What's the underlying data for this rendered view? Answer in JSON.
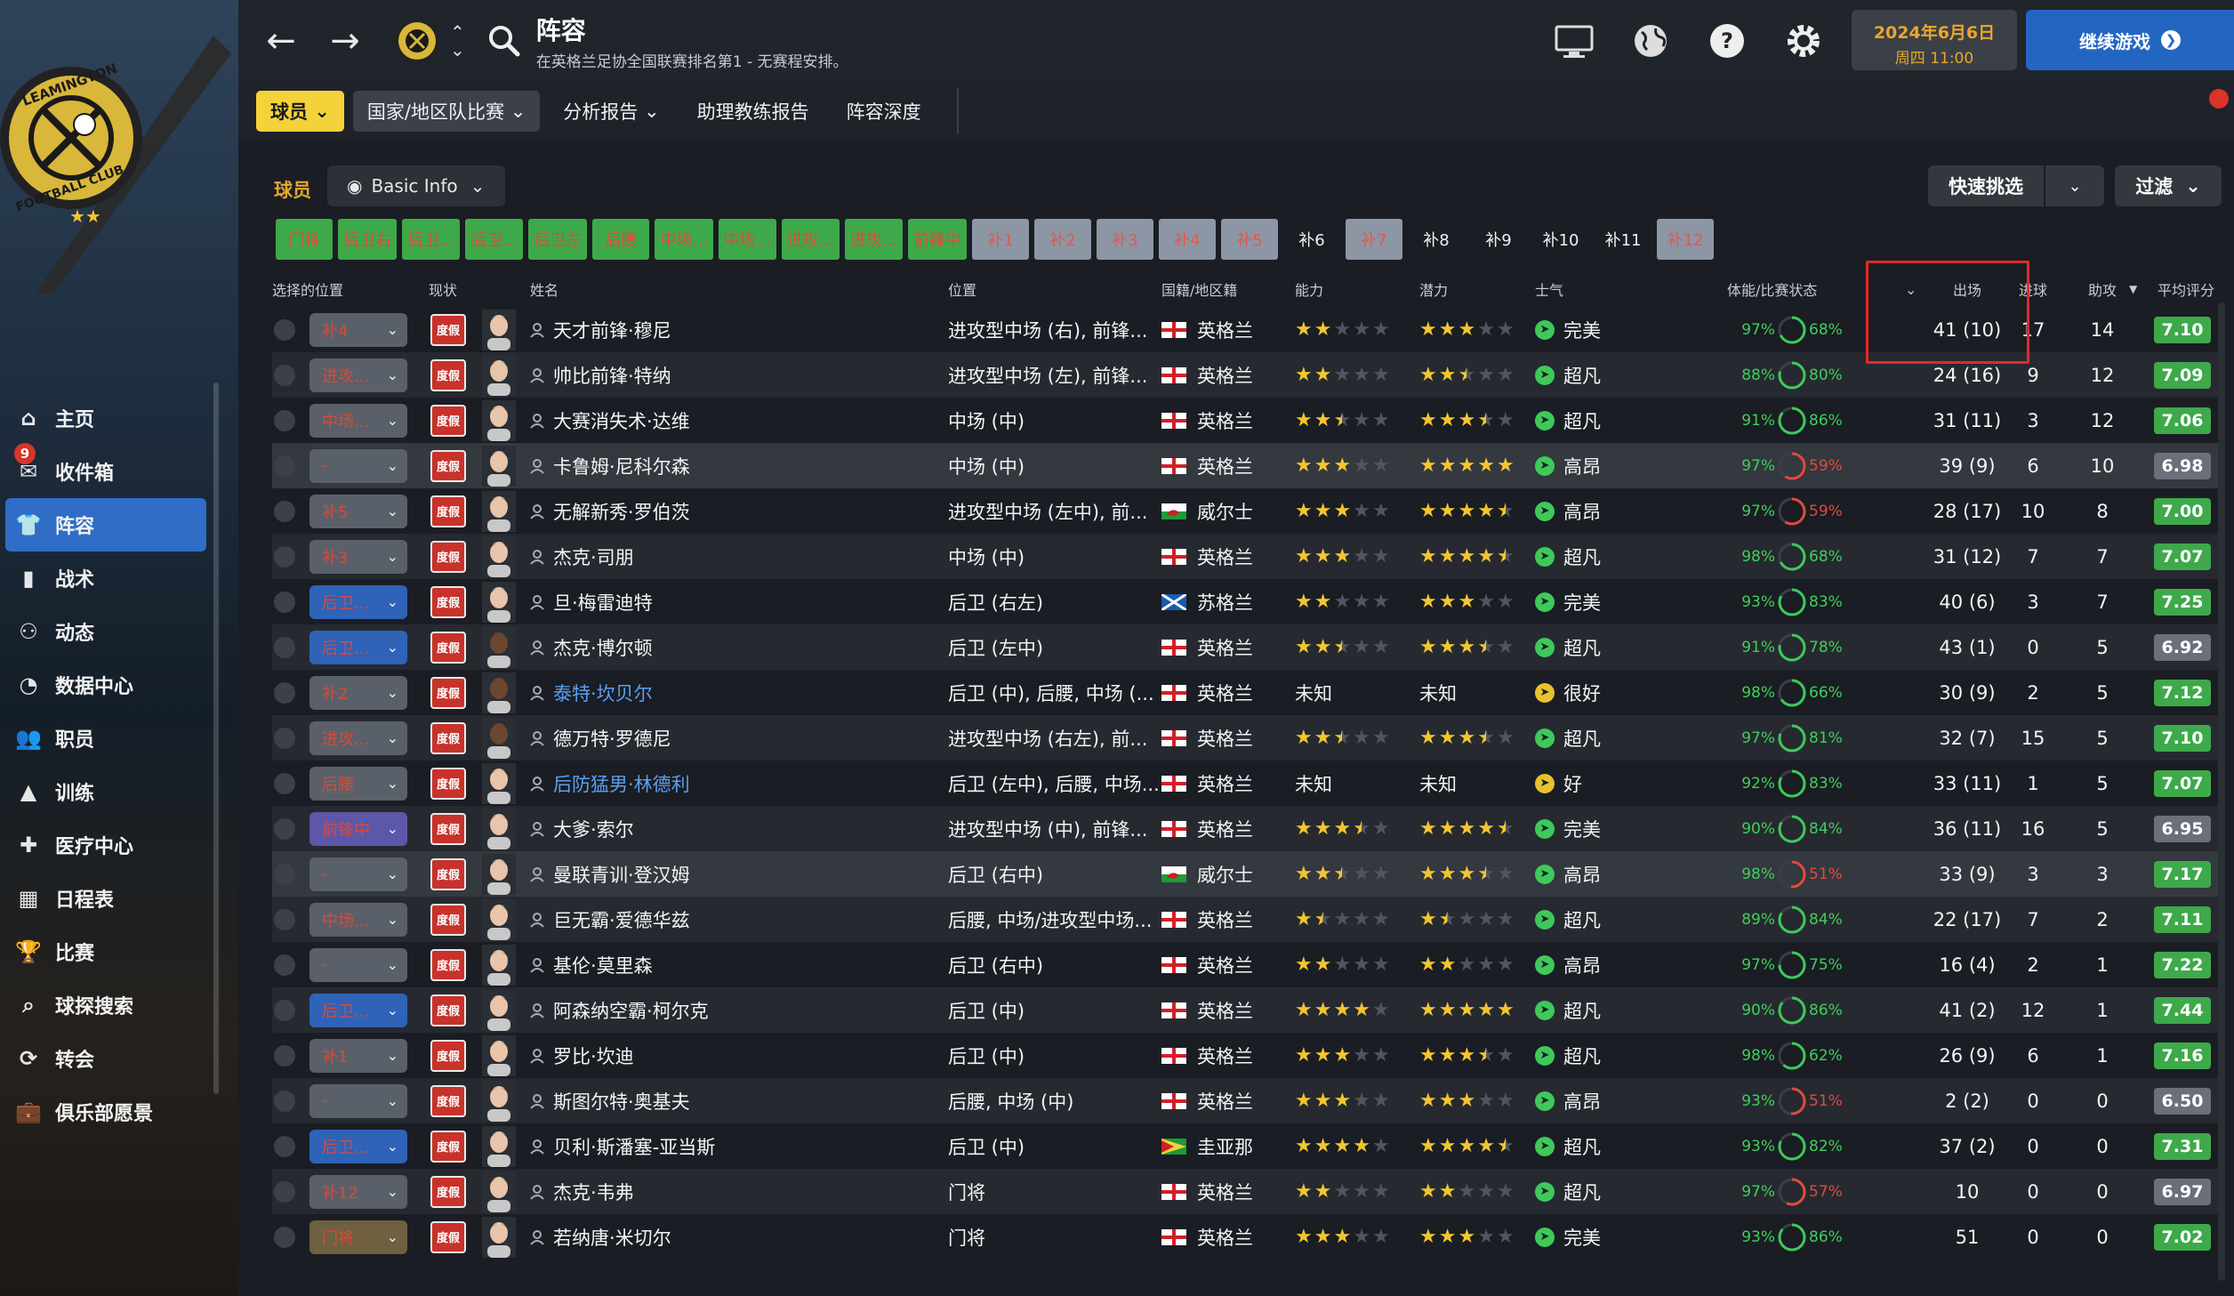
{
  "sidebar": {
    "club_crest_text": "LEAMINGTON FOOTBALL CLUB",
    "items": [
      {
        "label": "主页",
        "icon": "home-icon"
      },
      {
        "label": "收件箱",
        "icon": "inbox-icon",
        "badge": "9"
      },
      {
        "label": "阵容",
        "icon": "shirt-icon",
        "active": true
      },
      {
        "label": "战术",
        "icon": "tactics-icon"
      },
      {
        "label": "动态",
        "icon": "dynamics-icon"
      },
      {
        "label": "数据中心",
        "icon": "data-icon"
      },
      {
        "label": "职员",
        "icon": "staff-icon"
      },
      {
        "label": "训练",
        "icon": "training-icon"
      },
      {
        "label": "医疗中心",
        "icon": "medical-icon"
      },
      {
        "label": "日程表",
        "icon": "calendar-icon"
      },
      {
        "label": "比赛",
        "icon": "trophy-icon"
      },
      {
        "label": "球探搜索",
        "icon": "scout-icon"
      },
      {
        "label": "转会",
        "icon": "transfer-icon"
      },
      {
        "label": "俱乐部愿景",
        "icon": "briefcase-icon"
      }
    ]
  },
  "topbar": {
    "title": "阵容",
    "subtitle": "在英格兰足协全国联赛排名第1 - 无赛程安排。",
    "date": "2024年6月6日",
    "time": "周四 11:00",
    "continue": "继续游戏"
  },
  "subnav": {
    "tabs": [
      "球员",
      "国家/地区队比赛",
      "分析报告",
      "助理教练报告",
      "阵容深度"
    ]
  },
  "player_section": {
    "label": "球员",
    "view": "Basic Info",
    "quick_pick": "快速挑选",
    "filter": "过滤"
  },
  "chips": [
    {
      "label": "门将",
      "style": "green"
    },
    {
      "label": "后卫右",
      "style": "green"
    },
    {
      "label": "后卫...",
      "style": "green"
    },
    {
      "label": "后卫...",
      "style": "green"
    },
    {
      "label": "后卫左",
      "style": "green"
    },
    {
      "label": "后腰",
      "style": "green"
    },
    {
      "label": "中场...",
      "style": "green"
    },
    {
      "label": "中场...",
      "style": "green"
    },
    {
      "label": "进攻...",
      "style": "green"
    },
    {
      "label": "进攻...",
      "style": "green"
    },
    {
      "label": "前锋中",
      "style": "green"
    },
    {
      "label": "补1",
      "style": "grey"
    },
    {
      "label": "补2",
      "style": "grey"
    },
    {
      "label": "补3",
      "style": "grey"
    },
    {
      "label": "补4",
      "style": "grey"
    },
    {
      "label": "补5",
      "style": "grey"
    },
    {
      "label": "补6",
      "style": "dark"
    },
    {
      "label": "补7",
      "style": "grey"
    },
    {
      "label": "补8",
      "style": "dark"
    },
    {
      "label": "补9",
      "style": "dark"
    },
    {
      "label": "补10",
      "style": "dark"
    },
    {
      "label": "补11",
      "style": "dark"
    },
    {
      "label": "补12",
      "style": "grey"
    }
  ],
  "columns": {
    "select_pos": "选择的位置",
    "status": "现状",
    "name": "姓名",
    "position": "位置",
    "nationality": "国籍/地区籍",
    "ability": "能力",
    "potential": "潜力",
    "morale": "士气",
    "fitness": "体能/比赛状态",
    "apps": "出场",
    "goals": "进球",
    "assists": "助攻",
    "rating": "平均评分"
  },
  "status_label": "度假",
  "rows": [
    {
      "sel": "补4",
      "sel_color": "grey",
      "name": "天才前锋·穆尼",
      "position": "进攻型中场 (右), 前锋...",
      "flag": "eng",
      "nation": "英格兰",
      "ability": 2,
      "potential": 3,
      "morale": "完美",
      "morale_color": "green",
      "fit": "97%",
      "form": "68%",
      "form_color": "green",
      "apps": "41 (10)",
      "goals": "17",
      "assists": "14",
      "rating": "7.10",
      "blue": false
    },
    {
      "sel": "进攻...",
      "sel_color": "grey",
      "name": "帅比前锋·特纳",
      "position": "进攻型中场 (左), 前锋...",
      "flag": "eng",
      "nation": "英格兰",
      "ability": 2,
      "potential": 2.5,
      "morale": "超凡",
      "morale_color": "green",
      "fit": "88%",
      "form": "80%",
      "form_color": "green",
      "apps": "24 (16)",
      "goals": "9",
      "assists": "12",
      "rating": "7.09",
      "blue": false
    },
    {
      "sel": "中场...",
      "sel_color": "grey",
      "name": "大赛消失术·达维",
      "position": "中场 (中)",
      "flag": "eng",
      "nation": "英格兰",
      "ability": 2.5,
      "potential": 3.5,
      "morale": "超凡",
      "morale_color": "green",
      "fit": "91%",
      "form": "86%",
      "form_color": "green",
      "apps": "31 (11)",
      "goals": "3",
      "assists": "12",
      "rating": "7.06",
      "blue": false
    },
    {
      "sel": "-",
      "sel_color": "grey",
      "name": "卡鲁姆·尼科尔森",
      "position": "中场 (中)",
      "flag": "eng",
      "nation": "英格兰",
      "ability": 3,
      "potential": 5,
      "morale": "高昂",
      "morale_color": "green",
      "fit": "97%",
      "form": "59%",
      "form_color": "red",
      "apps": "39 (9)",
      "goals": "6",
      "assists": "10",
      "rating": "6.98",
      "blue": false
    },
    {
      "sel": "补5",
      "sel_color": "grey",
      "name": "无解新秀·罗伯茨",
      "position": "进攻型中场 (左中), 前...",
      "flag": "wal",
      "nation": "威尔士",
      "ability": 3,
      "potential": 4.5,
      "morale": "高昂",
      "morale_color": "green",
      "fit": "97%",
      "form": "59%",
      "form_color": "red",
      "apps": "28 (17)",
      "goals": "10",
      "assists": "8",
      "rating": "7.00",
      "blue": false
    },
    {
      "sel": "补3",
      "sel_color": "grey",
      "name": "杰克·司朋",
      "position": "中场 (中)",
      "flag": "eng",
      "nation": "英格兰",
      "ability": 3,
      "potential": 4.5,
      "morale": "超凡",
      "morale_color": "green",
      "fit": "98%",
      "form": "68%",
      "form_color": "green",
      "apps": "31 (12)",
      "goals": "7",
      "assists": "7",
      "rating": "7.07",
      "blue": false
    },
    {
      "sel": "后卫...",
      "sel_color": "blue",
      "name": "旦·梅雷迪特",
      "position": "后卫 (右左)",
      "flag": "sco",
      "nation": "苏格兰",
      "ability": 2,
      "potential": 3,
      "morale": "完美",
      "morale_color": "green",
      "fit": "93%",
      "form": "83%",
      "form_color": "green",
      "apps": "40 (6)",
      "goals": "3",
      "assists": "7",
      "rating": "7.25",
      "blue": false
    },
    {
      "sel": "后卫...",
      "sel_color": "blue",
      "name": "杰克·博尔顿",
      "position": "后卫 (左中)",
      "flag": "eng",
      "nation": "英格兰",
      "ability": 2.5,
      "potential": 3.5,
      "morale": "超凡",
      "morale_color": "green",
      "fit": "91%",
      "form": "78%",
      "form_color": "green",
      "apps": "43 (1)",
      "goals": "0",
      "assists": "5",
      "rating": "6.92",
      "blue": false
    },
    {
      "sel": "补2",
      "sel_color": "grey",
      "name": "泰特·坎贝尔",
      "position": "后卫 (中), 后腰, 中场 (...",
      "flag": "eng",
      "nation": "英格兰",
      "ability_text": "未知",
      "potential_text": "未知",
      "morale": "很好",
      "morale_color": "yellow",
      "fit": "98%",
      "form": "66%",
      "form_color": "green",
      "apps": "30 (9)",
      "goals": "2",
      "assists": "5",
      "rating": "7.12",
      "blue": true
    },
    {
      "sel": "进攻...",
      "sel_color": "grey",
      "name": "德万特·罗德尼",
      "position": "进攻型中场 (右左), 前...",
      "flag": "eng",
      "nation": "英格兰",
      "ability": 2.5,
      "potential": 3.5,
      "morale": "超凡",
      "morale_color": "green",
      "fit": "97%",
      "form": "81%",
      "form_color": "green",
      "apps": "32 (7)",
      "goals": "15",
      "assists": "5",
      "rating": "7.10",
      "blue": false
    },
    {
      "sel": "后腰",
      "sel_color": "grey",
      "name": "后防猛男·林德利",
      "position": "后卫 (左中), 后腰, 中场...",
      "flag": "eng",
      "nation": "英格兰",
      "ability_text": "未知",
      "potential_text": "未知",
      "morale": "好",
      "morale_color": "yellow",
      "fit": "92%",
      "form": "83%",
      "form_color": "green",
      "apps": "33 (11)",
      "goals": "1",
      "assists": "5",
      "rating": "7.07",
      "blue": true
    },
    {
      "sel": "前锋中",
      "sel_color": "purple",
      "name": "大爹·索尔",
      "position": "进攻型中场 (中), 前锋...",
      "flag": "eng",
      "nation": "英格兰",
      "ability": 3.5,
      "potential": 4.5,
      "morale": "完美",
      "morale_color": "green",
      "fit": "90%",
      "form": "84%",
      "form_color": "green",
      "apps": "36 (11)",
      "goals": "16",
      "assists": "5",
      "rating": "6.95",
      "blue": false
    },
    {
      "sel": "-",
      "sel_color": "grey",
      "name": "曼联青训·登汉姆",
      "position": "后卫 (右中)",
      "flag": "wal",
      "nation": "威尔士",
      "ability": 2.5,
      "potential": 3.5,
      "morale": "高昂",
      "morale_color": "green",
      "fit": "98%",
      "form": "51%",
      "form_color": "red",
      "apps": "33 (9)",
      "goals": "3",
      "assists": "3",
      "rating": "7.17",
      "blue": false
    },
    {
      "sel": "中场...",
      "sel_color": "grey",
      "name": "巨无霸·爱德华兹",
      "position": "后腰, 中场/进攻型中场...",
      "flag": "eng",
      "nation": "英格兰",
      "ability": 1.5,
      "potential": 1.5,
      "morale": "超凡",
      "morale_color": "green",
      "fit": "89%",
      "form": "84%",
      "form_color": "green",
      "apps": "22 (17)",
      "goals": "7",
      "assists": "2",
      "rating": "7.11",
      "blue": false
    },
    {
      "sel": "-",
      "sel_color": "grey",
      "name": "基伦·莫里森",
      "position": "后卫 (右中)",
      "flag": "eng",
      "nation": "英格兰",
      "ability": 2,
      "potential": 2,
      "morale": "高昂",
      "morale_color": "green",
      "fit": "97%",
      "form": "75%",
      "form_color": "green",
      "apps": "16 (4)",
      "goals": "2",
      "assists": "1",
      "rating": "7.22",
      "blue": false
    },
    {
      "sel": "后卫...",
      "sel_color": "blue",
      "name": "阿森纳空霸·柯尔克",
      "position": "后卫 (中)",
      "flag": "eng",
      "nation": "英格兰",
      "ability": 4,
      "potential": 5,
      "morale": "超凡",
      "morale_color": "green",
      "fit": "90%",
      "form": "86%",
      "form_color": "green",
      "apps": "41 (2)",
      "goals": "12",
      "assists": "1",
      "rating": "7.44",
      "blue": false
    },
    {
      "sel": "补1",
      "sel_color": "grey",
      "name": "罗比·坎迪",
      "position": "后卫 (中)",
      "flag": "eng",
      "nation": "英格兰",
      "ability": 3,
      "potential": 3.5,
      "morale": "超凡",
      "morale_color": "green",
      "fit": "98%",
      "form": "62%",
      "form_color": "green",
      "apps": "26 (9)",
      "goals": "6",
      "assists": "1",
      "rating": "7.16",
      "blue": false
    },
    {
      "sel": "-",
      "sel_color": "grey",
      "name": "斯图尔特·奥基夫",
      "position": "后腰, 中场 (中)",
      "flag": "eng",
      "nation": "英格兰",
      "ability": 3,
      "potential": 3,
      "morale": "高昂",
      "morale_color": "green",
      "fit": "93%",
      "form": "51%",
      "form_color": "red",
      "apps": "2 (2)",
      "goals": "0",
      "assists": "0",
      "rating": "6.50",
      "blue": false
    },
    {
      "sel": "后卫...",
      "sel_color": "blue",
      "name": "贝利·斯潘塞-亚当斯",
      "position": "后卫 (中)",
      "flag": "guy",
      "nation": "圭亚那",
      "ability": 4,
      "potential": 4.5,
      "morale": "超凡",
      "morale_color": "green",
      "fit": "93%",
      "form": "82%",
      "form_color": "green",
      "apps": "37 (2)",
      "goals": "0",
      "assists": "0",
      "rating": "7.31",
      "blue": false
    },
    {
      "sel": "补12",
      "sel_color": "grey",
      "name": "杰克·韦弗",
      "position": "门将",
      "flag": "eng",
      "nation": "英格兰",
      "ability": 2,
      "potential": 2,
      "morale": "超凡",
      "morale_color": "green",
      "fit": "97%",
      "form": "57%",
      "form_color": "red",
      "apps": "10",
      "goals": "0",
      "assists": "0",
      "rating": "6.97",
      "blue": false
    },
    {
      "sel": "门将",
      "sel_color": "olive",
      "name": "若纳唐·米切尔",
      "position": "门将",
      "flag": "eng",
      "nation": "英格兰",
      "ability": 3,
      "potential": 3,
      "morale": "完美",
      "morale_color": "green",
      "fit": "93%",
      "form": "86%",
      "form_color": "green",
      "apps": "51",
      "goals": "0",
      "assists": "0",
      "rating": "7.02",
      "blue": false
    }
  ],
  "colors": {
    "accent_blue": "#2366c2",
    "accent_yellow": "#f3d339",
    "rating_green": "#3ea94a",
    "highlight_red": "#e12a25"
  }
}
